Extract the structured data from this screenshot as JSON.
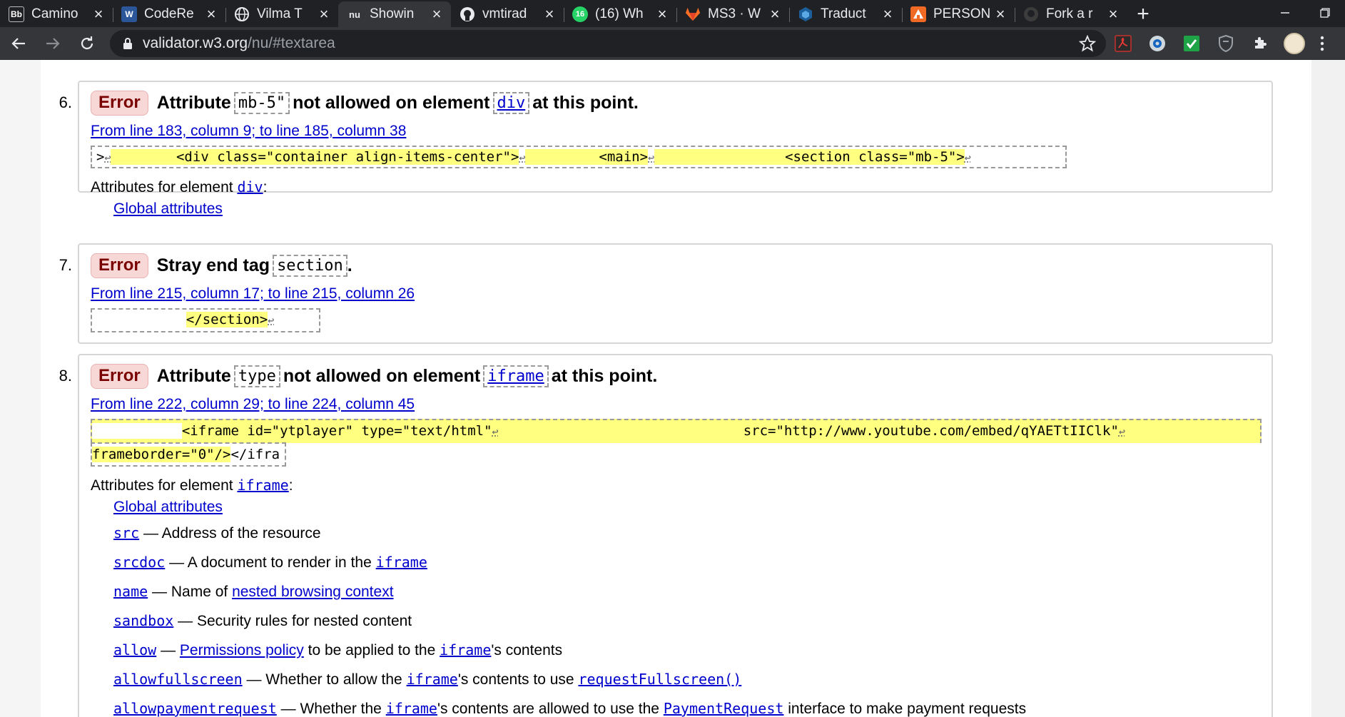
{
  "tabs": [
    {
      "title": "Camino",
      "favicon": "Bb",
      "fav_bg": "#202124",
      "icon": "blackboard-icon"
    },
    {
      "title": "CodeRe",
      "favicon": "W",
      "fav_bg": "#2b579a",
      "icon": "word-icon"
    },
    {
      "title": "Vilma T",
      "favicon": "",
      "fav_bg": "#202124",
      "icon": "globe-icon"
    },
    {
      "title": "Showin",
      "favicon": "nu",
      "fav_bg": "#35363a",
      "icon": "nu-validator-icon",
      "active": true
    },
    {
      "title": "vmtirad",
      "favicon": "",
      "fav_bg": "#202124",
      "icon": "github-icon"
    },
    {
      "title": "(16) Wh",
      "favicon": "16",
      "fav_bg": "#25d366",
      "icon": "whatsapp-icon"
    },
    {
      "title": "MS3 · W",
      "favicon": "",
      "fav_bg": "#202124",
      "icon": "gitlab-icon"
    },
    {
      "title": "Traduct",
      "favicon": "",
      "fav_bg": "#202124",
      "icon": "translate-icon"
    },
    {
      "title": "PERSON",
      "favicon": "",
      "fav_bg": "#f06a24",
      "icon": "personal-icon"
    },
    {
      "title": "Fork a r",
      "favicon": "",
      "fav_bg": "#202124",
      "icon": "github-icon"
    }
  ],
  "address": {
    "host": "validator.w3.org",
    "path": "/nu/#textarea"
  },
  "messages": [
    {
      "num": "6.",
      "badge": "Error",
      "pre": "Attribute",
      "code1": "mb-5\"",
      "mid": "not allowed on element",
      "code2": "div",
      "post": "at this point.",
      "location": "From line 183, column 9; to line 185, column 38",
      "extract": [
        ">",
        "        <div class=\"container align-items-center\">",
        "         <main>",
        "                <section class=\"mb-5\">"
      ],
      "attrs_label": "Attributes for element",
      "attrs_element": "div",
      "global": "Global attributes"
    },
    {
      "num": "7.",
      "badge": "Error",
      "pre": "Stray end tag",
      "code1": "section",
      "post": ".",
      "location": "From line 215, column 17; to line 215, column 26",
      "extract": "</section>"
    },
    {
      "num": "8.",
      "badge": "Error",
      "pre": "Attribute",
      "code1": "type",
      "mid": "not allowed on element",
      "code2": "iframe",
      "post": "at this point.",
      "location": "From line 222, column 29; to line 224, column 45",
      "extract_line1a": "<iframe id=\"ytplayer\" type=\"text/html\"",
      "extract_line1b": "src=\"http://www.youtube.com/embed/qYAETtIIClk\"",
      "extract_line2a": "frameborder=\"0\"/>",
      "extract_line2b": "</ifra",
      "attrs_label": "Attributes for element",
      "attrs_element": "iframe",
      "global": "Global attributes",
      "attr_list": [
        {
          "name": "src",
          "desc": "— Address of the resource"
        },
        {
          "name": "srcdoc",
          "desc": "— A document to render in the",
          "link": "iframe"
        },
        {
          "name": "name",
          "desc": "— Name of",
          "link": "nested browsing context",
          "link_plain": true
        },
        {
          "name": "sandbox",
          "desc": "— Security rules for nested content"
        },
        {
          "name": "allow",
          "desc": "—",
          "link": "Permissions policy",
          "link_plain": true,
          "desc2": "to be applied to the",
          "link2": "iframe",
          "desc3": "'s contents"
        },
        {
          "name": "allowfullscreen",
          "desc": "— Whether to allow the",
          "link": "iframe",
          "desc2": "'s contents to use",
          "link2": "requestFullscreen()"
        },
        {
          "name": "allowpaymentrequest",
          "desc": "— Whether the",
          "link": "iframe",
          "desc2": "'s contents are allowed to use the",
          "link2": "PaymentRequest",
          "desc3": "interface to make payment requests"
        }
      ]
    }
  ]
}
